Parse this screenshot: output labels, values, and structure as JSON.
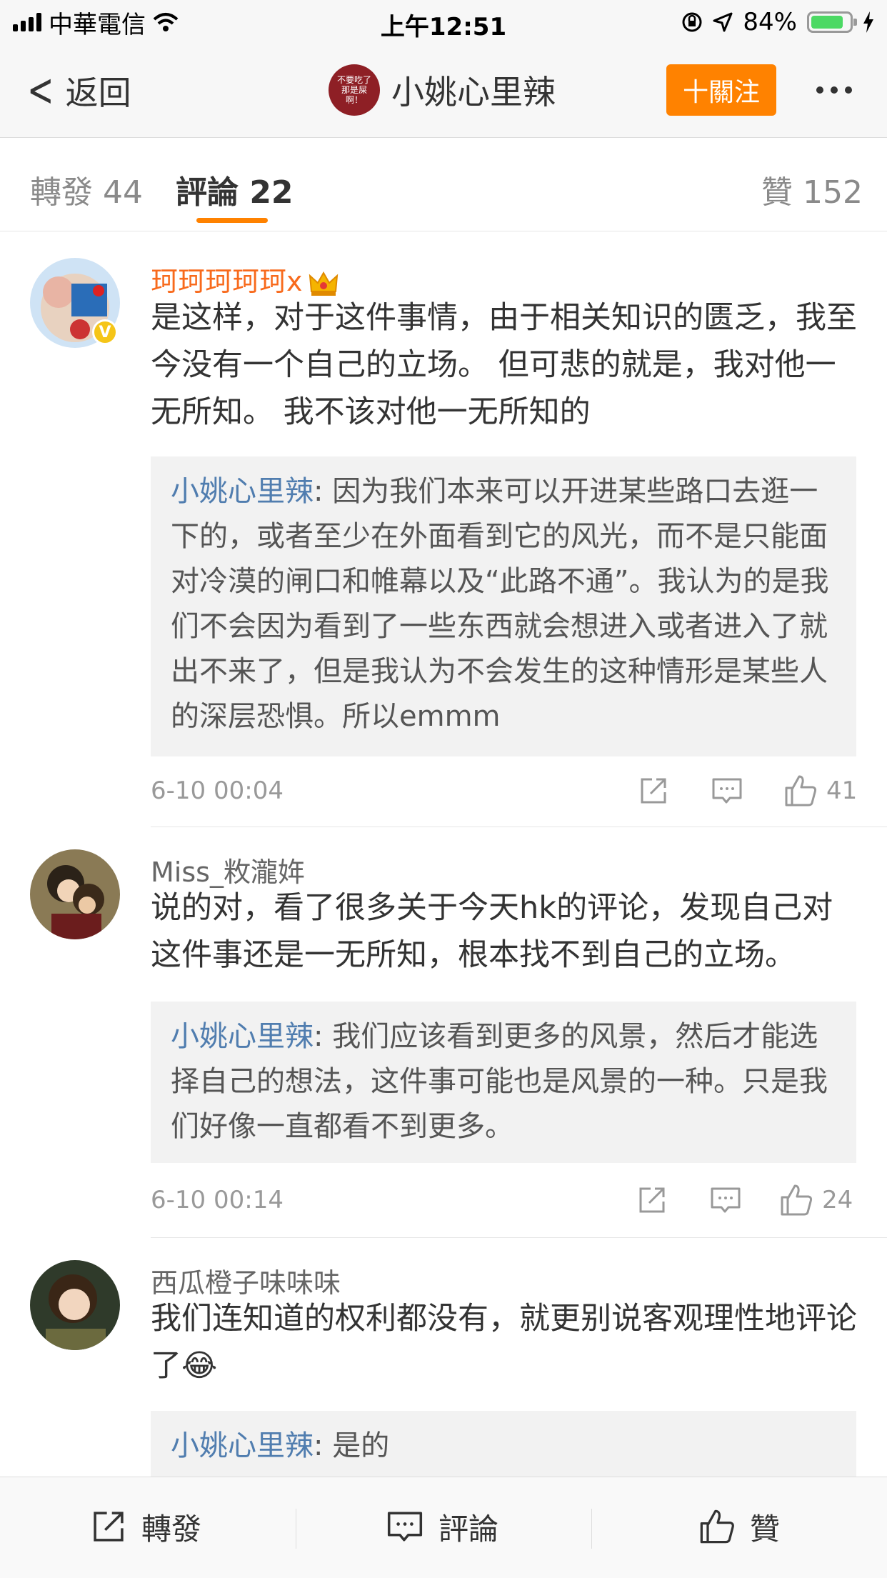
{
  "status_bar": {
    "carrier": "中華電信",
    "time": "上午12:51",
    "battery": "84%",
    "battery_level": 0.84
  },
  "nav": {
    "back_label": "返回",
    "title": "小姚心里辣",
    "avatar_text": "不要吃了那是屎啊！",
    "follow_label": "十關注"
  },
  "tabs": {
    "repost": "轉發 44",
    "comments": "評論 22",
    "likes": "贊 152"
  },
  "comments": [
    {
      "username": "珂珂珂珂珂x",
      "text": "是这样，对于这件事情，由于相关知识的匮乏，我至今没有一个自己的立场。 但可悲的就是，我对他一无所知。 我不该对他一无所知的",
      "reply_user": "小姚心里辣",
      "reply_text": ": 因为我们本来可以开进某些路口去逛一下的，或者至少在外面看到它的风光，而不是只能面对冷漠的闸口和帷幕以及“此路不通”。我认为的是我们不会因为看到了一些东西就会想进入或者进入了就出不来了，但是我认为不会发生的这种情形是某些人的深层恐惧。所以emmm",
      "time": "6-10 00:04",
      "likes": "41"
    },
    {
      "username": "Miss_敉瀧姩",
      "text": "说的对，看了很多关于今天hk的评论，发现自己对这件事还是一无所知，根本找不到自己的立场。",
      "reply_user": "小姚心里辣",
      "reply_text": ": 我们应该看到更多的风景，然后才能选择自己的想法，这件事可能也是风景的一种。只是我们好像一直都看不到更多。",
      "time": "6-10 00:14",
      "likes": "24"
    },
    {
      "username": "西瓜橙子味味味",
      "text": "我们连知道的权利都没有，就更别说客观理性地评论了",
      "emoji": "😂",
      "reply_user": "小姚心里辣",
      "reply_text": ": 是的"
    }
  ],
  "bottom_bar": {
    "repost": "轉發",
    "comment": "評論",
    "like": "贊"
  },
  "colors": {
    "accent_orange": "#ff8200",
    "username_orange": "#f86a1c",
    "reply_user_blue": "#507daf",
    "vip_gold": "#f5c518"
  }
}
